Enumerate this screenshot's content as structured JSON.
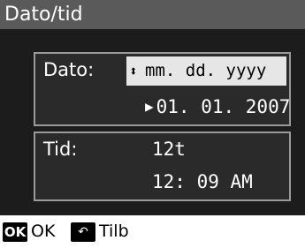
{
  "header": {
    "title": "Dato/tid"
  },
  "date": {
    "label": "Dato:",
    "format_arrow_icon": "up-down-arrow-icon",
    "format_arrow": "⬍",
    "format_value": "mm. dd. yyyy",
    "cursor_icon": "right-triangle-icon",
    "cursor": "▶",
    "value": "01. 01. 2007"
  },
  "time": {
    "label": "Tid:",
    "clock_mode": "12t",
    "value": "12: 09   AM"
  },
  "footer": {
    "ok_badge": "OK",
    "ok_label": "OK",
    "back_icon": "back-arrow-icon",
    "back_badge": "↶",
    "back_label": "Tilb"
  },
  "colors": {
    "title_bar": "#5a5a5a",
    "panel": "#1c1c1c",
    "box_border": "#9a9a9a",
    "selected_field": "#e6e6e6"
  }
}
